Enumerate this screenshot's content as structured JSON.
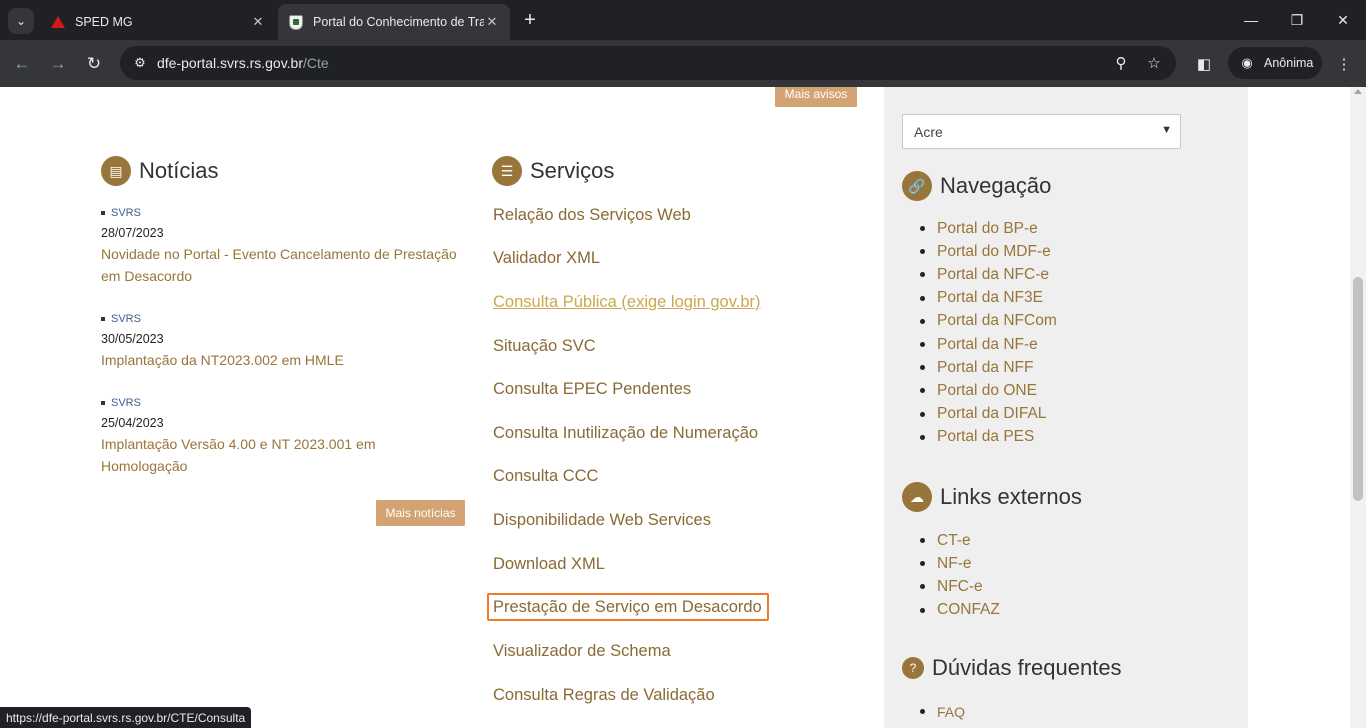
{
  "browser": {
    "tabs": [
      {
        "title": "SPED MG",
        "active": false
      },
      {
        "title": "Portal do Conhecimento de Tra",
        "active": true
      }
    ],
    "address": {
      "host": "dfe-portal.svrs.rs.gov.br",
      "path": "/Cte"
    },
    "profile_label": "Anônima",
    "status_url": "https://dfe-portal.svrs.rs.gov.br/CTE/Consulta"
  },
  "page": {
    "more_notices_label": "Mais avisos",
    "news": {
      "heading": "Notícias",
      "items": [
        {
          "tag": "SVRS",
          "date": "28/07/2023",
          "title": "Novidade no Portal - Evento Cancelamento de Prestação em Desacordo"
        },
        {
          "tag": "SVRS",
          "date": "30/05/2023",
          "title": "Implantação da NT2023.002 em HMLE"
        },
        {
          "tag": "SVRS",
          "date": "25/04/2023",
          "title": "Implantação Versão 4.00 e NT 2023.001 em Homologação"
        }
      ],
      "more_label": "Mais notícias"
    },
    "services": {
      "heading": "Serviços",
      "items": [
        "Relação dos Serviços Web",
        "Validador XML",
        "Consulta Pública (exige login gov.br)",
        "Situação SVC",
        "Consulta EPEC Pendentes",
        "Consulta Inutilização de Numeração",
        "Consulta CCC",
        "Disponibilidade Web Services",
        "Download XML",
        "Prestação de Serviço em Desacordo",
        "Visualizador de Schema",
        "Consulta Regras de Validação"
      ]
    },
    "sidebar": {
      "state_select": "Acre",
      "navigation": {
        "heading": "Navegação",
        "items": [
          "Portal do BP-e",
          "Portal do MDF-e",
          "Portal da NFC-e",
          "Portal da NF3E",
          "Portal da NFCom",
          "Portal da NF-e",
          "Portal da NFF",
          "Portal do ONE",
          "Portal da DIFAL",
          "Portal da PES"
        ]
      },
      "external": {
        "heading": "Links externos",
        "items": [
          "CT-e",
          "NF-e",
          "NFC-e",
          "CONFAZ"
        ]
      },
      "faq": {
        "heading": "Dúvidas frequentes",
        "items": [
          "FAQ"
        ]
      }
    }
  }
}
